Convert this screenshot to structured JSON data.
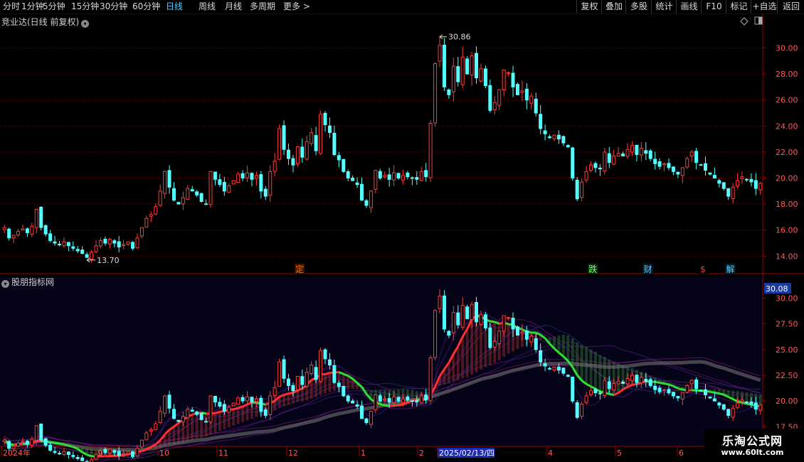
{
  "toolbar": {
    "periods": [
      "分时",
      "1分钟",
      "5分钟",
      "15分钟",
      "30分钟",
      "60分钟",
      "日线",
      "周线",
      "月线",
      "多周期",
      "更多 >"
    ],
    "active_period": "日线",
    "right_buttons": [
      "复权",
      "叠加",
      "多股",
      "统计",
      "画线",
      "F10",
      "标记",
      "+自选",
      "返回"
    ]
  },
  "main_panel": {
    "title": "竞业达(日线 前复权)",
    "title_icon": "chevron-down-icon",
    "high_label": "30.86",
    "low_label": "13.70"
  },
  "indicator_panel": {
    "title": "股朋指标网",
    "current_value": "30.08"
  },
  "event_tags": [
    {
      "text": "定",
      "color": "#ff6a00",
      "bg": "#3a1600",
      "x_index": 64
    },
    {
      "text": "跌",
      "color": "#77ff77",
      "bg": "#0a2a0a",
      "x_index": 128
    },
    {
      "text": "财",
      "color": "#55ccff",
      "bg": "#001a2a",
      "x_index": 140
    },
    {
      "text": "$",
      "color": "#ff3333",
      "bg": "#000000",
      "x_index": 152
    },
    {
      "text": "解",
      "color": "#55ccff",
      "bg": "#001a2a",
      "x_index": 158
    }
  ],
  "x_axis": {
    "labels": [
      "2024年",
      "9",
      "10",
      "11",
      "12",
      "1",
      "2",
      "2025/02/13/四",
      "4",
      "5",
      "6"
    ],
    "highlight": "2025/02/13/四"
  },
  "watermark": {
    "title": "乐淘公式网",
    "url": "www.60lt.com"
  },
  "colors": {
    "up": "#ff3b3b",
    "down": "#54ffff",
    "grid": "#7a0000",
    "border": "#a00000",
    "axis_text": "#c8c8c8",
    "ma_up": "#ff3030",
    "ma_down": "#30e030"
  },
  "chart_data": {
    "type": "candlestick",
    "y_axis_main": {
      "ticks": [
        14,
        16,
        18,
        20,
        22,
        24,
        26,
        28,
        30
      ],
      "range": [
        13.2,
        31.5
      ]
    },
    "y_axis_indicator": {
      "ticks": [
        17.5,
        20,
        22.5,
        25,
        27.5,
        30
      ],
      "range": [
        15.8,
        31.0
      ]
    },
    "close": [
      16.2,
      15.4,
      15.6,
      15.9,
      16.1,
      15.8,
      16.3,
      17.6,
      16.2,
      15.7,
      15.2,
      15.0,
      14.9,
      15.1,
      14.8,
      14.6,
      14.4,
      14.2,
      13.9,
      14.3,
      14.8,
      15.2,
      15.0,
      15.3,
      15.0,
      14.7,
      14.9,
      15.1,
      14.6,
      15.4,
      16.2,
      16.9,
      17.2,
      17.8,
      19.0,
      20.5,
      19.3,
      18.3,
      18.0,
      18.5,
      19.2,
      19.0,
      18.7,
      18.2,
      18.0,
      20.5,
      19.9,
      19.5,
      19.0,
      19.4,
      19.8,
      20.3,
      20.0,
      20.4,
      19.9,
      20.2,
      19.0,
      18.6,
      20.5,
      21.3,
      23.8,
      22.2,
      21.5,
      21.0,
      22.4,
      21.6,
      22.8,
      23.5,
      22.1,
      24.9,
      24.1,
      23.5,
      21.8,
      21.4,
      20.5,
      20.0,
      19.8,
      19.5,
      18.3,
      17.9,
      19.0,
      20.6,
      20.0,
      20.2,
      19.9,
      20.4,
      20.0,
      20.2,
      20.1,
      20.0,
      19.9,
      20.5,
      20.1,
      24.2,
      28.8,
      30.2,
      27.0,
      26.4,
      28.6,
      27.4,
      29.3,
      28.0,
      29.4,
      27.7,
      28.4,
      27.1,
      25.2,
      25.8,
      26.8,
      28.3,
      28.1,
      27.0,
      26.4,
      26.7,
      26.0,
      26.3,
      25.0,
      23.8,
      23.4,
      23.1,
      23.3,
      23.0,
      22.7,
      22.4,
      20.0,
      18.4,
      19.7,
      20.5,
      21.0,
      20.8,
      20.7,
      22.0,
      21.2,
      21.7,
      21.9,
      21.7,
      22.2,
      22.5,
      21.8,
      22.3,
      21.9,
      21.5,
      21.1,
      20.9,
      21.1,
      20.8,
      20.5,
      20.3,
      20.8,
      21.5,
      22.0,
      21.2,
      21.0,
      20.6,
      20.3,
      20.0,
      19.6,
      19.2,
      18.6,
      19.3,
      19.8,
      20.1,
      19.9,
      19.7,
      19.2,
      19.6
    ],
    "high": [
      30.86
    ],
    "low": [
      13.7
    ]
  }
}
